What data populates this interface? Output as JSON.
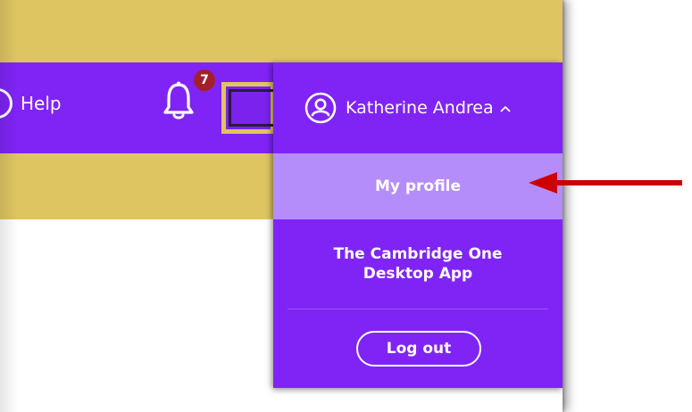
{
  "header": {
    "help_label": "Help",
    "notification_count": "7",
    "user_name": "Katherine Andrea"
  },
  "dropdown": {
    "items": [
      {
        "label": "My profile",
        "highlighted": true
      },
      {
        "label": "The Cambridge One Desktop App",
        "line1": "The Cambridge One",
        "line2": "Desktop App"
      }
    ],
    "logout_label": "Log out"
  },
  "icons": {
    "help": "help-circle-icon",
    "notifications": "bell-icon",
    "user": "user-circle-icon",
    "menu_toggle": "chevron-up-icon",
    "annotation": "red-arrow-left"
  },
  "colors": {
    "header_purple": "#8024f6",
    "gold": "#dfc562",
    "highlight": "#b48dfa",
    "badge_red": "#a3202a",
    "arrow_red": "#cc0000"
  }
}
